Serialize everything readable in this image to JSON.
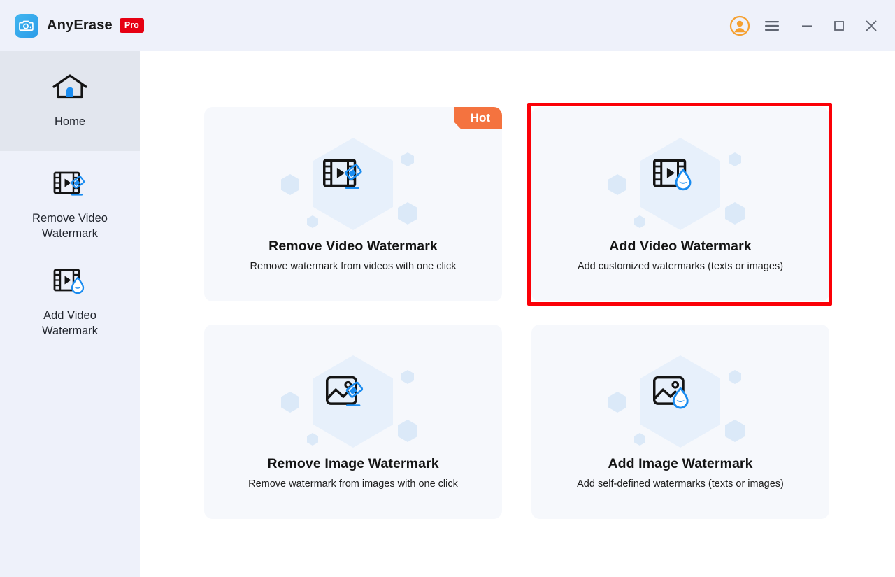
{
  "window": {
    "brand_name": "AnyErase",
    "pro_badge": "Pro",
    "logo_icon": "camera-eraser-icon",
    "controls": [
      {
        "name": "account-avatar",
        "icon": "user-avatar-icon",
        "label": ""
      },
      {
        "name": "menu-button",
        "icon": "hamburger-menu-icon",
        "label": ""
      },
      {
        "name": "minimize-button",
        "icon": "minimize-icon",
        "label": ""
      },
      {
        "name": "maximize-button",
        "icon": "maximize-icon",
        "label": ""
      },
      {
        "name": "close-button",
        "icon": "close-icon",
        "label": ""
      }
    ]
  },
  "sidebar": {
    "items": [
      {
        "id": "home",
        "label": "Home",
        "icon": "home-icon",
        "active": true
      },
      {
        "id": "remove-video-watermark",
        "label": "Remove Video\nWatermark",
        "line1": "Remove Video",
        "line2": "Watermark",
        "icon": "video-eraser-icon",
        "active": false
      },
      {
        "id": "add-video-watermark",
        "label": "Add Video\nWatermark",
        "line1": "Add Video",
        "line2": "Watermark",
        "icon": "video-droplet-icon",
        "active": false
      }
    ]
  },
  "main": {
    "cards": [
      {
        "id": "remove-video-watermark",
        "title": "Remove Video Watermark",
        "subtitle": "Remove watermark from videos with one click",
        "icon": "video-eraser-icon",
        "badge": "Hot",
        "highlighted": false
      },
      {
        "id": "add-video-watermark",
        "title": "Add Video Watermark",
        "subtitle": "Add customized watermarks (texts or images)",
        "icon": "video-droplet-icon",
        "badge": "",
        "highlighted": true
      },
      {
        "id": "remove-image-watermark",
        "title": "Remove Image Watermark",
        "subtitle": "Remove watermark from images with one click",
        "icon": "image-eraser-icon",
        "badge": "",
        "highlighted": false
      },
      {
        "id": "add-image-watermark",
        "title": "Add Image Watermark",
        "subtitle": "Add self-defined watermarks  (texts or images)",
        "icon": "image-droplet-icon",
        "badge": "",
        "highlighted": false
      }
    ]
  },
  "colors": {
    "titlebar_bg": "#eef1fa",
    "sidebar_bg": "#eef1fa",
    "sidebar_active_bg": "#e2e6ee",
    "card_bg": "#f6f8fc",
    "accent_blue": "#1a8cf0",
    "pro_red": "#e60012",
    "hot_orange": "#f4733f",
    "avatar_orange": "#f5a030",
    "highlight_red": "#fb0007",
    "hex_large": "#e7f0fb",
    "hex_small": "#dbe9f8"
  }
}
